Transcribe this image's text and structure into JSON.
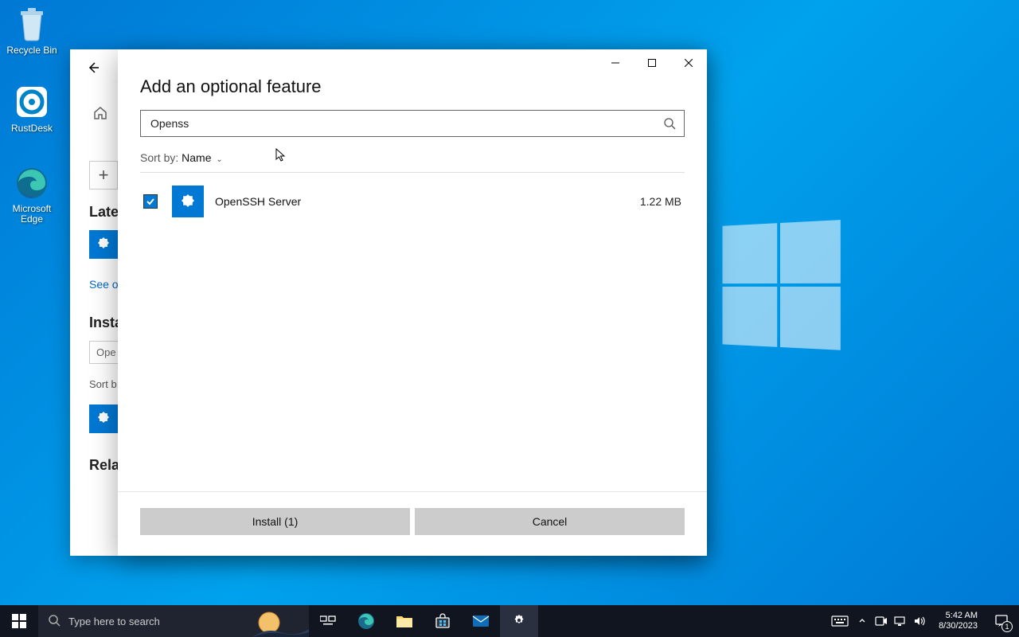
{
  "desktop": {
    "icons": [
      {
        "label": "Recycle Bin"
      },
      {
        "label": "RustDesk"
      },
      {
        "label": "Microsoft Edge"
      }
    ]
  },
  "bg_window": {
    "latest_heading": "Late",
    "see_link": "See o",
    "installed_heading": "Insta",
    "filter_value": "Ope",
    "sort_label": "Sort b",
    "related_heading": "Rela"
  },
  "modal": {
    "title": "Add an optional feature",
    "search_value": "Openss",
    "sort_label": "Sort by:",
    "sort_value": "Name",
    "features": [
      {
        "name": "OpenSSH Server",
        "size": "1.22 MB",
        "checked": true
      }
    ],
    "install_label": "Install (1)",
    "cancel_label": "Cancel"
  },
  "taskbar": {
    "search_placeholder": "Type here to search",
    "time": "5:42 AM",
    "date": "8/30/2023",
    "notif_count": "1"
  }
}
